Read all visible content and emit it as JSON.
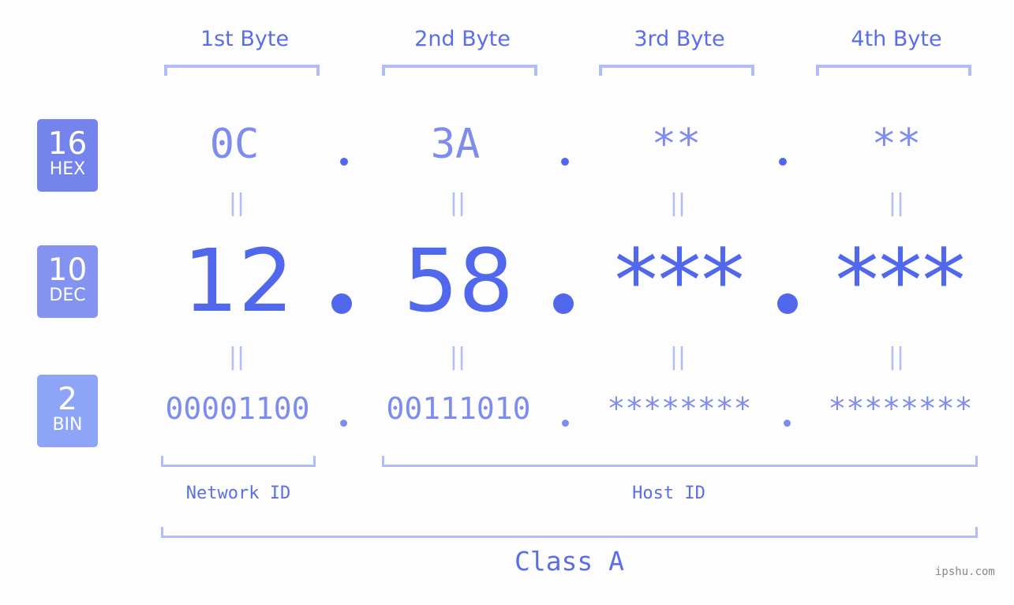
{
  "bytes": [
    {
      "header": "1st Byte",
      "hex": "0C",
      "dec": "12",
      "bin": "00001100"
    },
    {
      "header": "2nd Byte",
      "hex": "3A",
      "dec": "58",
      "bin": "00111010"
    },
    {
      "header": "3rd Byte",
      "hex": "**",
      "dec": "***",
      "bin": "********"
    },
    {
      "header": "4th Byte",
      "hex": "**",
      "dec": "***",
      "bin": "********"
    }
  ],
  "badges": {
    "hex": {
      "num": "16",
      "label": "HEX",
      "color": "#7583ec"
    },
    "dec": {
      "num": "10",
      "label": "DEC",
      "color": "#8593f0"
    },
    "bin": {
      "num": "2",
      "label": "BIN",
      "color": "#8ea5f7"
    }
  },
  "equals_symbol": "||",
  "network_id_label": "Network ID",
  "host_id_label": "Host ID",
  "class_label": "Class A",
  "watermark": "ipshu.com",
  "colors": {
    "primary": "#5168ec",
    "secondary": "#7e8ded",
    "bracket": "#b3bdf5"
  }
}
